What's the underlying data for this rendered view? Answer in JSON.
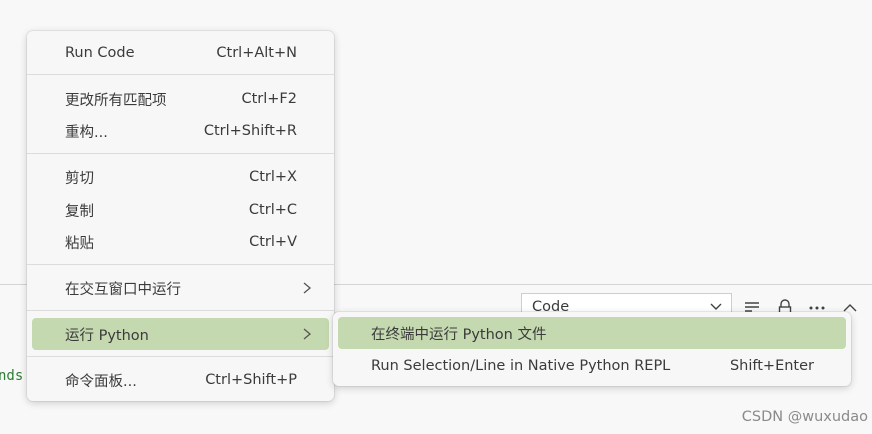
{
  "context_menu": {
    "items": [
      {
        "label": "Run Code",
        "shortcut": "Ctrl+Alt+N"
      },
      {
        "label": "更改所有匹配项",
        "shortcut": "Ctrl+F2"
      },
      {
        "label": "重构...",
        "shortcut": "Ctrl+Shift+R"
      },
      {
        "label": "剪切",
        "shortcut": "Ctrl+X"
      },
      {
        "label": "复制",
        "shortcut": "Ctrl+C"
      },
      {
        "label": "粘贴",
        "shortcut": "Ctrl+V"
      },
      {
        "label": "在交互窗口中运行",
        "shortcut": ""
      },
      {
        "label": "运行 Python",
        "shortcut": ""
      },
      {
        "label": "命令面板...",
        "shortcut": "Ctrl+Shift+P"
      }
    ]
  },
  "submenu": {
    "items": [
      {
        "label": "在终端中运行 Python 文件",
        "shortcut": ""
      },
      {
        "label": "Run Selection/Line in Native Python REPL",
        "shortcut": "Shift+Enter"
      }
    ]
  },
  "panel": {
    "output_select_value": "Code",
    "terminal_fragment": "nds"
  },
  "watermark": "CSDN @wuxudao",
  "colors": {
    "highlight": "#c5d9b0",
    "menu_bg": "#f7f7f7",
    "terminal_text": "#2e7d32"
  },
  "icons": [
    "chevron-down-icon",
    "word-wrap-icon",
    "lock-icon",
    "more-icon",
    "chevron-up-icon",
    "chevron-right-icon"
  ]
}
